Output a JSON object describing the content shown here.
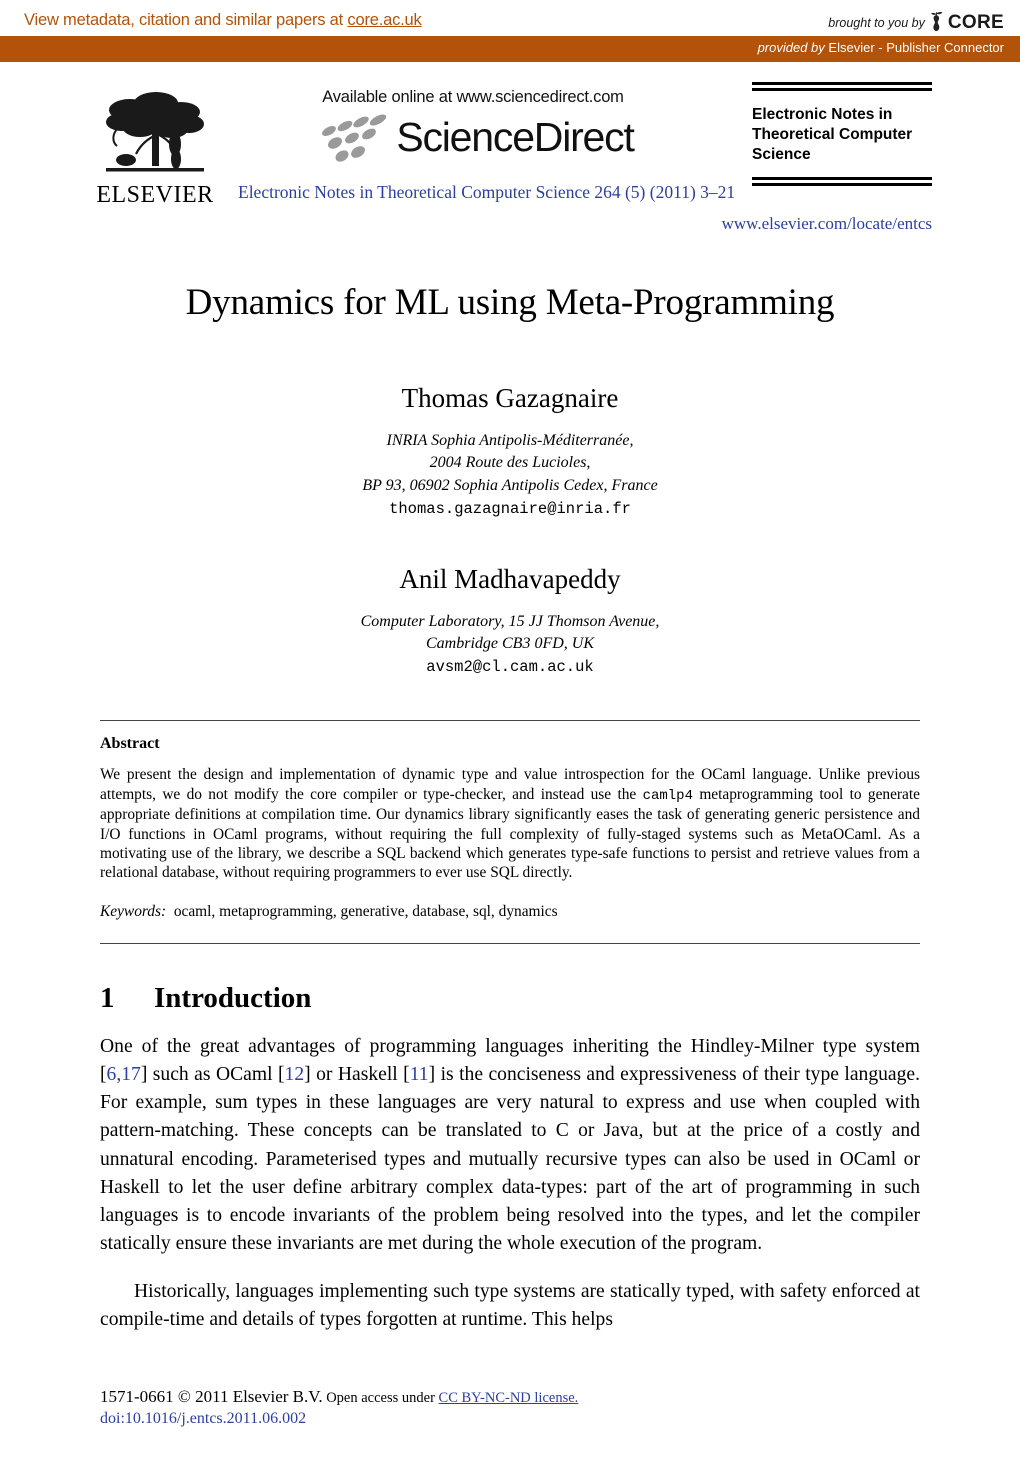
{
  "core_banner": {
    "metadata_prefix": "View metadata, citation and similar papers at ",
    "metadata_link": "core.ac.uk",
    "brought_by_label": "brought to you by",
    "core_wordmark": "CORE",
    "provided_by_italic": "provided by",
    "provided_by_rest": " Elsevier - Publisher Connector",
    "accent_color": "#b25309"
  },
  "journal_header": {
    "publisher_name": "ELSEVIER",
    "available_online": "Available online at www.sciencedirect.com",
    "sciencedirect_wordmark": "ScienceDirect",
    "journal_reference": "Electronic Notes in Theoretical Computer Science 264 (5) (2011) 3–21",
    "journal_title": "Electronic Notes in Theoretical Computer Science",
    "journal_url": "www.elsevier.com/locate/entcs",
    "link_color": "#2c3e9e"
  },
  "paper": {
    "title": "Dynamics for ML using Meta-Programming",
    "authors": [
      {
        "name": "Thomas Gazagnaire",
        "affiliation_lines": [
          "INRIA Sophia Antipolis-Méditerranée,",
          "2004 Route des Lucioles,",
          "BP 93, 06902 Sophia Antipolis Cedex, France"
        ],
        "email": "thomas.gazagnaire@inria.fr"
      },
      {
        "name": "Anil Madhavapeddy",
        "affiliation_lines": [
          "Computer Laboratory, 15 JJ Thomson Avenue,",
          "Cambridge CB3 0FD, UK"
        ],
        "email": "avsm2@cl.cam.ac.uk"
      }
    ]
  },
  "abstract": {
    "heading": "Abstract",
    "part1": "We present the design and implementation of dynamic type and value introspection for the OCaml language. Unlike previous attempts, we do not modify the core compiler or type-checker, and instead use the ",
    "code_term": "camlp4",
    "part2": " metaprogramming tool to generate appropriate definitions at compilation time. Our dynamics library significantly eases the task of generating generic persistence and I/O functions in OCaml programs, without requiring the full complexity of fully-staged systems such as MetaOCaml. As a motivating use of the library, we describe a SQL backend which generates type-safe functions to persist and retrieve values from a relational database, without requiring programmers to ever use SQL directly.",
    "keywords_label": "Keywords:",
    "keywords_value": "ocaml, metaprogramming, generative, database, sql, dynamics"
  },
  "section": {
    "number": "1",
    "title": "Introduction",
    "paragraph1": {
      "seg1": "One of the great advantages of programming languages inheriting the Hindley-Milner type system [",
      "cite1": "6,17",
      "seg2": "] such as OCaml [",
      "cite2": "12",
      "seg3": "] or Haskell [",
      "cite3": "11",
      "seg4": "] is the conciseness and expressiveness of their type language. For example, sum types in these languages are very natural to express and use when coupled with pattern-matching. These concepts can be translated to C or Java, but at the price of a costly and unnatural encoding. Parameterised types and mutually recursive types can also be used in OCaml or Haskell to let the user define arbitrary complex data-types: part of the art of programming in such languages is to encode invariants of the problem being resolved into the types, and let the compiler statically ensure these invariants are met during the whole execution of the program."
    },
    "paragraph2": "Historically, languages implementing such type systems are statically typed, with safety enforced at compile-time and details of types forgotten at runtime. This helps"
  },
  "footer": {
    "issn_copyright": "1571-0661 © 2011 Elsevier B.V.",
    "open_access": " Open access under ",
    "license": "CC BY-NC-ND license.",
    "doi": "doi:10.1016/j.entcs.2011.06.002"
  }
}
